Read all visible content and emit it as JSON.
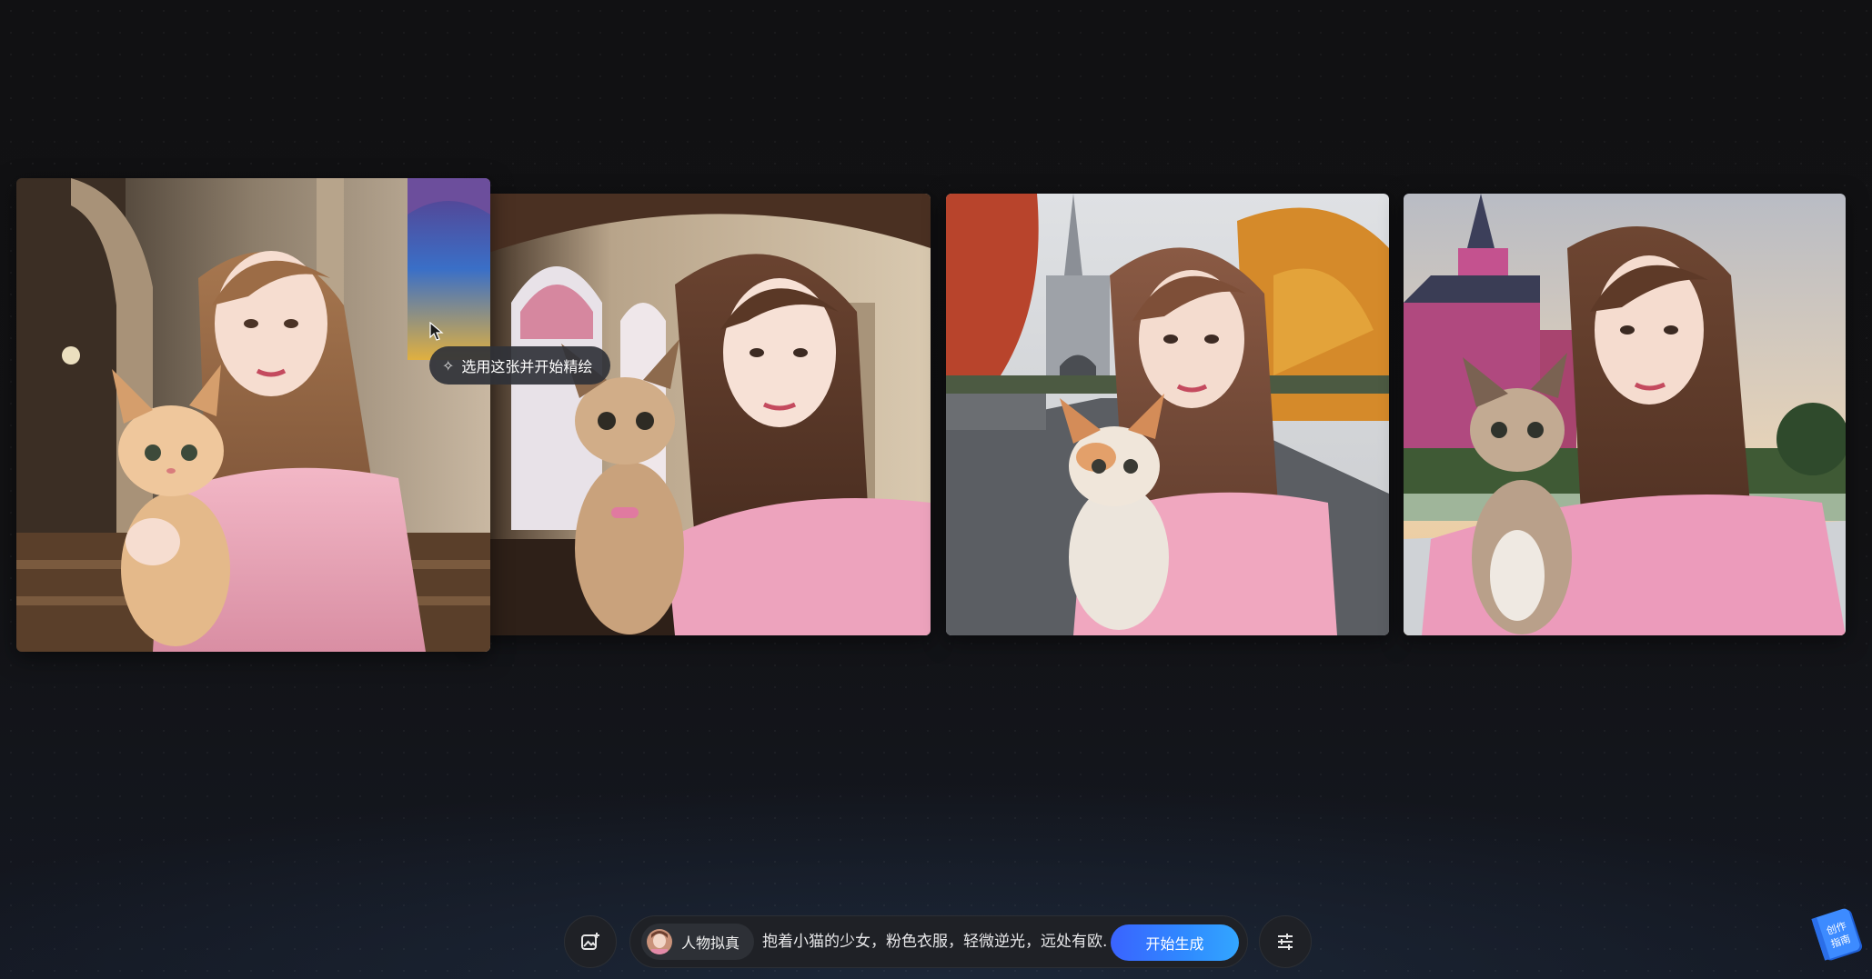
{
  "tooltip": {
    "label": "选用这张并开始精绘",
    "icon": "sparkle-icon"
  },
  "prompt_bar": {
    "upload_icon": "image-upload-icon",
    "style_chip_label": "人物拟真",
    "prompt_text": "抱着小猫的少女，粉色衣服，轻微逆光，远处有欧...",
    "generate_label": "开始生成",
    "settings_icon": "sliders-icon"
  },
  "guide_badge": {
    "label_line1": "创作",
    "label_line2": "指南"
  },
  "images": [
    {
      "name": "result-image-1",
      "scene": "church-interior-stained-glass"
    },
    {
      "name": "result-image-2",
      "scene": "church-interior-arches"
    },
    {
      "name": "result-image-3",
      "scene": "street-gothic-cathedral-autumn"
    },
    {
      "name": "result-image-4",
      "scene": "pink-cathedral-sunset"
    }
  ],
  "colors": {
    "accent": "#3a6bff",
    "background": "#121214",
    "pill": "#1f2126"
  }
}
